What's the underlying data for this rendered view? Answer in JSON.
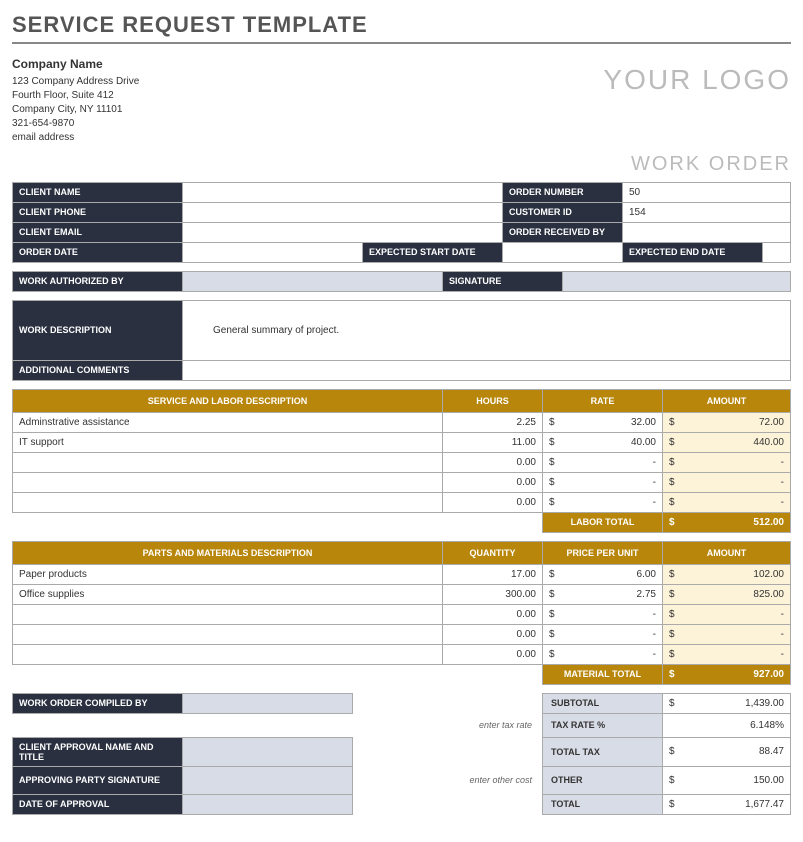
{
  "title": "SERVICE REQUEST TEMPLATE",
  "company": {
    "name": "Company Name",
    "addr1": "123 Company Address Drive",
    "addr2": "Fourth Floor, Suite 412",
    "addr3": "Company City, NY  11101",
    "phone": "321-654-9870",
    "email": "email address"
  },
  "logo": "YOUR LOGO",
  "work_order_label": "WORK ORDER",
  "labels": {
    "client_name": "CLIENT NAME",
    "client_phone": "CLIENT PHONE",
    "client_email": "CLIENT EMAIL",
    "order_number": "ORDER NUMBER",
    "customer_id": "CUSTOMER ID",
    "order_received_by": "ORDER RECEIVED BY",
    "order_date": "ORDER DATE",
    "expected_start": "EXPECTED START DATE",
    "expected_end": "EXPECTED END DATE",
    "work_authorized_by": "WORK AUTHORIZED BY",
    "signature": "SIGNATURE",
    "work_description": "WORK DESCRIPTION",
    "additional_comments": "ADDITIONAL COMMENTS",
    "work_order_compiled_by": "WORK ORDER COMPILED BY",
    "client_approval": "CLIENT APPROVAL NAME AND TITLE",
    "approving_party_sig": "APPROVING PARTY SIGNATURE",
    "date_of_approval": "DATE OF APPROVAL",
    "enter_tax_rate": "enter tax rate",
    "enter_other_cost": "enter other cost"
  },
  "values": {
    "order_number": "50",
    "customer_id": "154",
    "work_description": "General summary of project."
  },
  "service_table": {
    "headers": {
      "desc": "SERVICE AND LABOR DESCRIPTION",
      "hours": "HOURS",
      "rate": "RATE",
      "amount": "AMOUNT"
    },
    "rows": [
      {
        "desc": "Adminstrative assistance",
        "hours": "2.25",
        "rate": "32.00",
        "amount": "72.00"
      },
      {
        "desc": "IT support",
        "hours": "11.00",
        "rate": "40.00",
        "amount": "440.00"
      },
      {
        "desc": "",
        "hours": "0.00",
        "rate": "-",
        "amount": "-"
      },
      {
        "desc": "",
        "hours": "0.00",
        "rate": "-",
        "amount": "-"
      },
      {
        "desc": "",
        "hours": "0.00",
        "rate": "-",
        "amount": "-"
      }
    ],
    "total_label": "LABOR TOTAL",
    "total": "512.00"
  },
  "parts_table": {
    "headers": {
      "desc": "PARTS AND MATERIALS DESCRIPTION",
      "qty": "QUANTITY",
      "price": "PRICE PER UNIT",
      "amount": "AMOUNT"
    },
    "rows": [
      {
        "desc": "Paper products",
        "qty": "17.00",
        "price": "6.00",
        "amount": "102.00"
      },
      {
        "desc": "Office supplies",
        "qty": "300.00",
        "price": "2.75",
        "amount": "825.00"
      },
      {
        "desc": "",
        "qty": "0.00",
        "price": "-",
        "amount": "-"
      },
      {
        "desc": "",
        "qty": "0.00",
        "price": "-",
        "amount": "-"
      },
      {
        "desc": "",
        "qty": "0.00",
        "price": "-",
        "amount": "-"
      }
    ],
    "total_label": "MATERIAL TOTAL",
    "total": "927.00"
  },
  "totals": {
    "subtotal_label": "SUBTOTAL",
    "subtotal": "1,439.00",
    "tax_rate_label": "TAX RATE %",
    "tax_rate": "6.148%",
    "total_tax_label": "TOTAL TAX",
    "total_tax": "88.47",
    "other_label": "OTHER",
    "other": "150.00",
    "total_label": "TOTAL",
    "total": "1,677.47"
  },
  "currency": "$"
}
